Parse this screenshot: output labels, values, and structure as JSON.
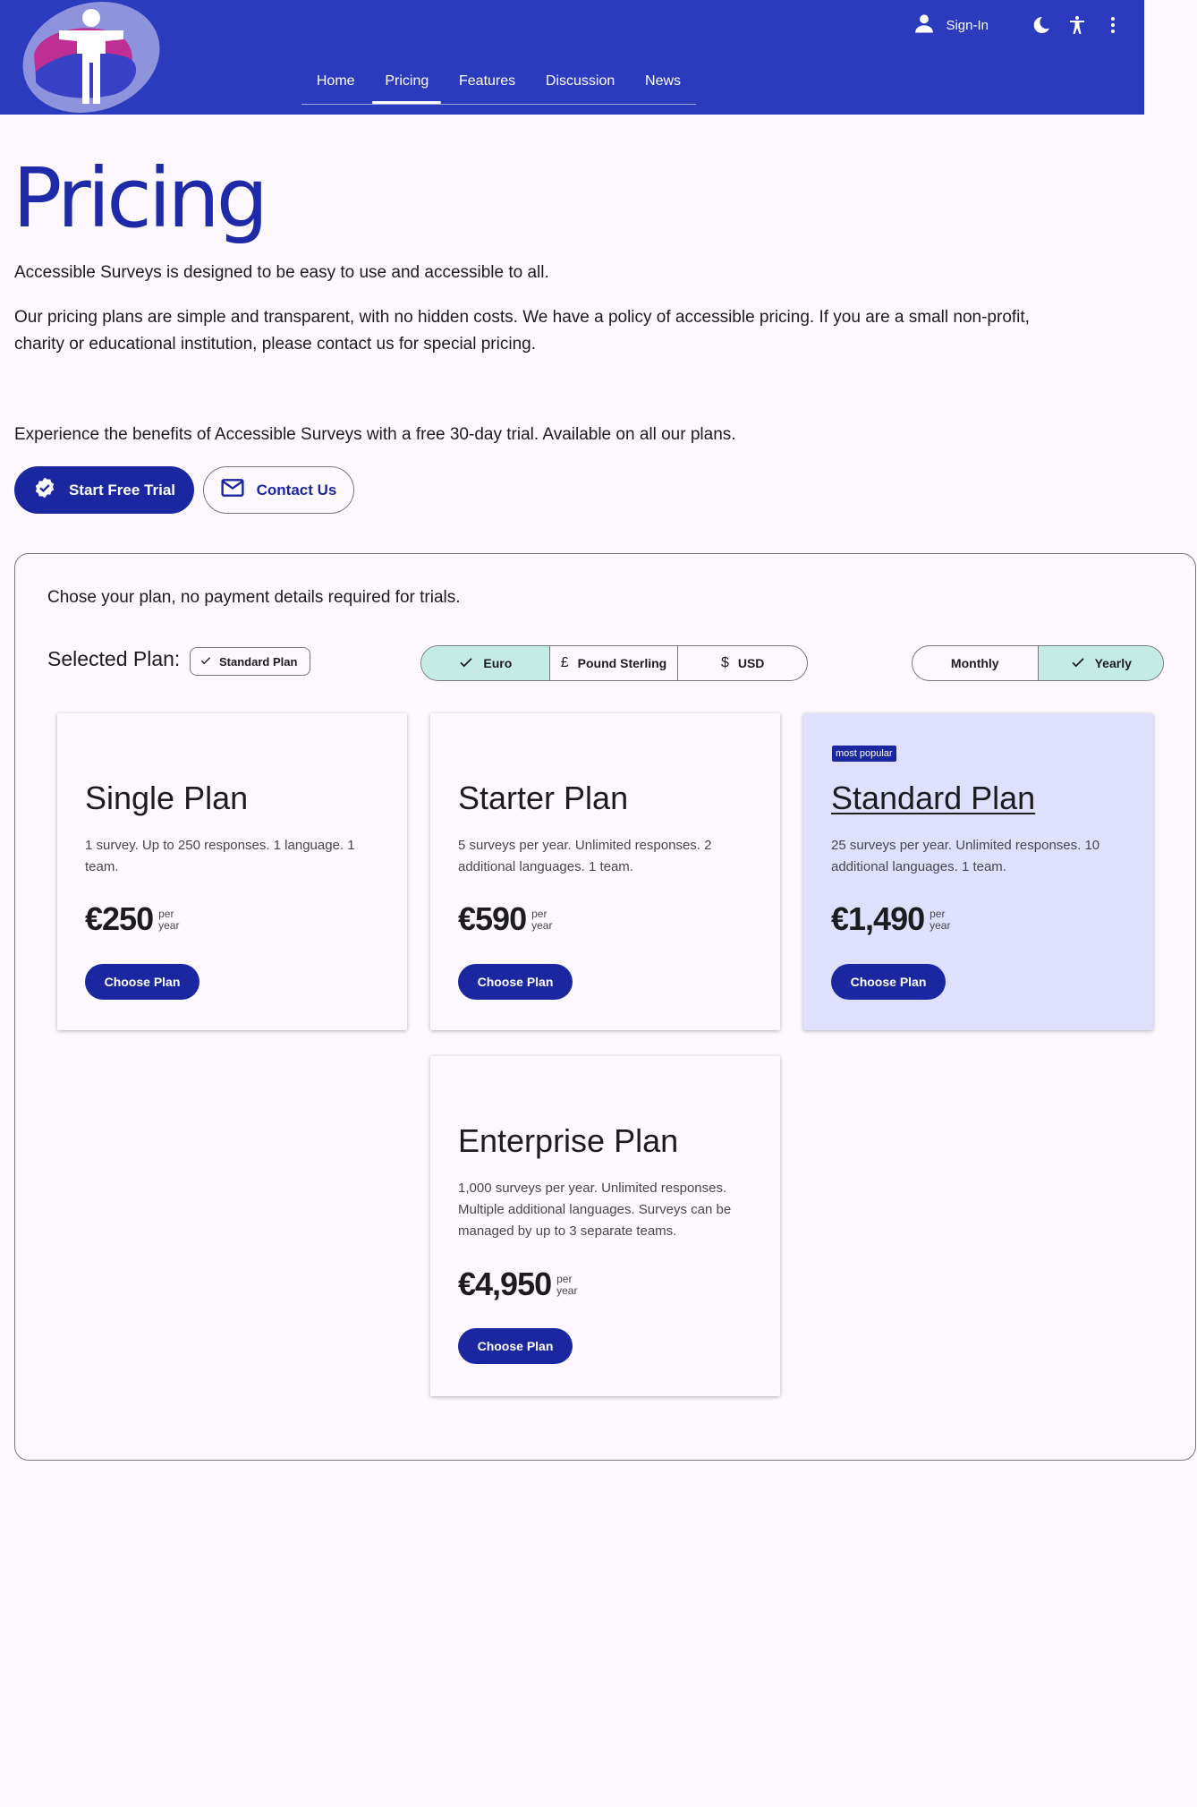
{
  "header": {
    "signin_label": "Sign-In",
    "nav": [
      "Home",
      "Pricing",
      "Features",
      "Discussion",
      "News"
    ],
    "active_nav": "Pricing"
  },
  "intro": {
    "title": "Pricing",
    "p1": "Accessible Surveys is designed to be easy to use and accessible to all.",
    "p2_line1": "Our pricing plans are simple and transparent, with no hidden costs. We have a policy of accessible pricing. If you are a small non-profit,",
    "p2_line2": "charity or educational institution, please contact us for special pricing.",
    "p3": "Experience the benefits of Accessible Surveys with a free 30-day trial. Available on all our plans.",
    "trial_button": "Start Free Trial",
    "contact_button": "Contact Us"
  },
  "plans": {
    "intro": "Chose your plan, no payment details required for trials.",
    "selected_label": "Selected Plan:",
    "selected_value": "Standard Plan",
    "currencies": [
      {
        "label": "Euro",
        "symbol": "",
        "selected": true
      },
      {
        "label": "Pound Sterling",
        "symbol": "£",
        "selected": false
      },
      {
        "label": "USD",
        "symbol": "$",
        "selected": false
      }
    ],
    "periods": [
      {
        "label": "Monthly",
        "selected": false
      },
      {
        "label": "Yearly",
        "selected": true
      }
    ],
    "badge": "most popular",
    "choose_label": "Choose Plan",
    "per": "per",
    "year": "year",
    "cards": [
      {
        "name": "Single Plan",
        "desc": "1 survey. Up to 250 responses. 1 language. 1 team.",
        "price": "€250"
      },
      {
        "name": "Starter Plan",
        "desc": "5 surveys per year. Unlimited responses. 2 additional languages. 1 team.",
        "price": "€590"
      },
      {
        "name": "Standard Plan",
        "desc": "25 surveys per year. Unlimited responses. 10 additional languages. 1 team.",
        "price": "€1,490"
      },
      {
        "name": "Enterprise Plan",
        "desc": "1,000 surveys per year. Unlimited responses. Multiple additional languages. Surveys can be managed by up to 3 separate teams.",
        "price": "€4,950"
      }
    ]
  },
  "colors": {
    "header_bg": "#2b3bbd",
    "primary": "#1a27a0",
    "selected_segment": "#c4ece4",
    "highlight_card": "#dee0fd"
  }
}
